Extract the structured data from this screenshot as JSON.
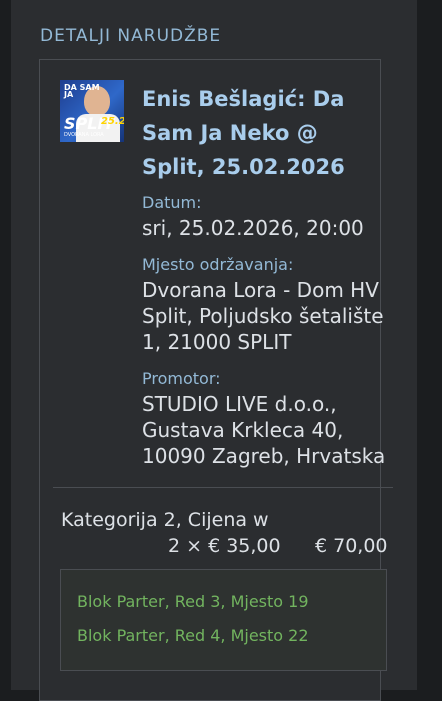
{
  "section": {
    "title": "DETALJI NARUDŽBE"
  },
  "event": {
    "title": "Enis Bešlagić: Da Sam Ja Neko @ Split, 25.02.2026",
    "poster": {
      "l1": "DA SAM",
      "l2": "JA",
      "city": "SPLIT",
      "date": "25.2",
      "sub": "DVORANA LORA"
    },
    "date_label": "Datum:",
    "date_value": "sri, 25.02.2026, 20:00",
    "venue_label": "Mjesto održavanja:",
    "venue_value": "Dvorana Lora - Dom HV Split, Poljudsko šetalište 1, 21000 SPLIT",
    "promoter_label": "Promotor:",
    "promoter_value": "STUDIO LIVE d.o.o., Gustava Krkleca 40, 10090 Zagreb, Hrvatska"
  },
  "order": {
    "category_line": "Kategorija 2, Cijena w",
    "qty_price": "2 × € 35,00",
    "total": "€ 70,00",
    "seats": [
      "Blok Parter, Red 3, Mjesto 19",
      "Blok Parter, Red 4, Mjesto 22"
    ]
  },
  "colors": {
    "accent": "#93b9d6",
    "title": "#a9cdec",
    "seat": "#72b45f",
    "background": "#1b1d1f"
  }
}
